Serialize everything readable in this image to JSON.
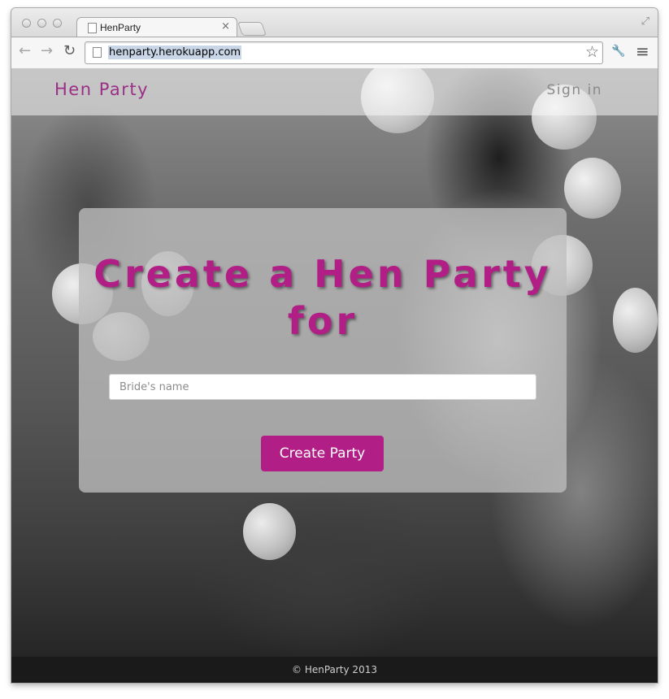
{
  "browser": {
    "tab": {
      "title": "HenParty",
      "close_glyph": "×"
    },
    "toolbar": {
      "back_glyph": "←",
      "forward_glyph": "→",
      "reload_glyph": "↻",
      "url": "henparty.herokuapp.com",
      "star_glyph": "☆",
      "wrench_glyph": "🔧",
      "menu_glyph": "≡"
    },
    "resize_glyph": "⤢"
  },
  "site": {
    "nav": {
      "brand": "Hen Party",
      "signin": "Sign in"
    },
    "hero": {
      "title": "Create a Hen Party for",
      "input_placeholder": "Bride's name",
      "button_label": "Create Party"
    },
    "footer": {
      "text": "© HenParty 2013"
    },
    "colors": {
      "accent": "#b11f86",
      "brand_text": "#9b2f86",
      "signin_text": "#8a8a8a"
    }
  }
}
